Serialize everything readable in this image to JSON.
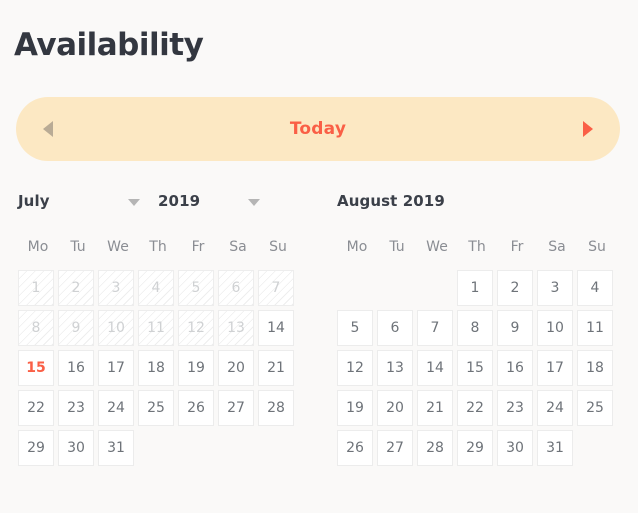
{
  "page": {
    "title": "Availability",
    "background_color": "#faf9f8",
    "title_color": "#333740"
  },
  "toolbar": {
    "today_label": "Today",
    "prev_icon": "triangle-left-icon",
    "next_icon": "triangle-right-icon",
    "prev_arrow_color": "#b9ab95",
    "next_arrow_color": "#fa5f46",
    "accent_color": "#fa5f46",
    "bar_color": "#fce8c3"
  },
  "calendars": [
    {
      "id": "july-2019",
      "has_selects": true,
      "month_label": "July",
      "year_label": "2019",
      "weekdays": [
        "Mo",
        "Tu",
        "We",
        "Th",
        "Fr",
        "Sa",
        "Su"
      ],
      "lead_blanks": 0,
      "days": [
        {
          "n": "1",
          "state": "disabled"
        },
        {
          "n": "2",
          "state": "disabled"
        },
        {
          "n": "3",
          "state": "disabled"
        },
        {
          "n": "4",
          "state": "disabled"
        },
        {
          "n": "5",
          "state": "disabled"
        },
        {
          "n": "6",
          "state": "disabled"
        },
        {
          "n": "7",
          "state": "disabled"
        },
        {
          "n": "8",
          "state": "disabled"
        },
        {
          "n": "9",
          "state": "disabled"
        },
        {
          "n": "10",
          "state": "disabled"
        },
        {
          "n": "11",
          "state": "disabled"
        },
        {
          "n": "12",
          "state": "disabled"
        },
        {
          "n": "13",
          "state": "disabled"
        },
        {
          "n": "14",
          "state": "enabled"
        },
        {
          "n": "15",
          "state": "today"
        },
        {
          "n": "16",
          "state": "enabled"
        },
        {
          "n": "17",
          "state": "enabled"
        },
        {
          "n": "18",
          "state": "enabled"
        },
        {
          "n": "19",
          "state": "enabled"
        },
        {
          "n": "20",
          "state": "enabled"
        },
        {
          "n": "21",
          "state": "enabled"
        },
        {
          "n": "22",
          "state": "enabled"
        },
        {
          "n": "23",
          "state": "enabled"
        },
        {
          "n": "24",
          "state": "enabled"
        },
        {
          "n": "25",
          "state": "enabled"
        },
        {
          "n": "26",
          "state": "enabled"
        },
        {
          "n": "27",
          "state": "enabled"
        },
        {
          "n": "28",
          "state": "enabled"
        },
        {
          "n": "29",
          "state": "enabled"
        },
        {
          "n": "30",
          "state": "enabled"
        },
        {
          "n": "31",
          "state": "enabled"
        }
      ]
    },
    {
      "id": "august-2019",
      "has_selects": false,
      "title": "August 2019",
      "weekdays": [
        "Mo",
        "Tu",
        "We",
        "Th",
        "Fr",
        "Sa",
        "Su"
      ],
      "lead_blanks": 3,
      "days": [
        {
          "n": "1",
          "state": "enabled"
        },
        {
          "n": "2",
          "state": "enabled"
        },
        {
          "n": "3",
          "state": "enabled"
        },
        {
          "n": "4",
          "state": "enabled"
        },
        {
          "n": "5",
          "state": "enabled"
        },
        {
          "n": "6",
          "state": "enabled"
        },
        {
          "n": "7",
          "state": "enabled"
        },
        {
          "n": "8",
          "state": "enabled"
        },
        {
          "n": "9",
          "state": "enabled"
        },
        {
          "n": "10",
          "state": "enabled"
        },
        {
          "n": "11",
          "state": "enabled"
        },
        {
          "n": "12",
          "state": "enabled"
        },
        {
          "n": "13",
          "state": "enabled"
        },
        {
          "n": "14",
          "state": "enabled"
        },
        {
          "n": "15",
          "state": "enabled"
        },
        {
          "n": "16",
          "state": "enabled"
        },
        {
          "n": "17",
          "state": "enabled"
        },
        {
          "n": "18",
          "state": "enabled"
        },
        {
          "n": "19",
          "state": "enabled"
        },
        {
          "n": "20",
          "state": "enabled"
        },
        {
          "n": "21",
          "state": "enabled"
        },
        {
          "n": "22",
          "state": "enabled"
        },
        {
          "n": "23",
          "state": "enabled"
        },
        {
          "n": "24",
          "state": "enabled"
        },
        {
          "n": "25",
          "state": "enabled"
        },
        {
          "n": "26",
          "state": "enabled"
        },
        {
          "n": "27",
          "state": "enabled"
        },
        {
          "n": "28",
          "state": "enabled"
        },
        {
          "n": "29",
          "state": "enabled"
        },
        {
          "n": "30",
          "state": "enabled"
        },
        {
          "n": "31",
          "state": "enabled"
        }
      ]
    }
  ]
}
